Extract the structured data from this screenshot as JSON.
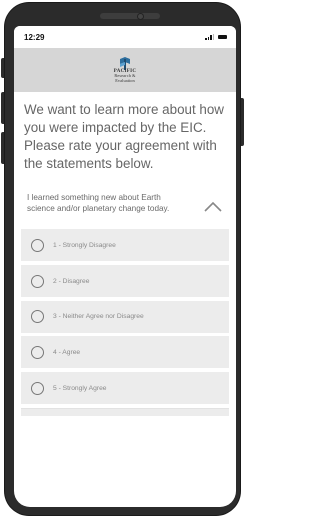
{
  "status_bar": {
    "time": "12:29"
  },
  "header": {
    "logo_icon": "pacific-logo-icon",
    "logo_line1": "PACIFIC",
    "logo_line2": "Research &",
    "logo_line3": "Evaluation"
  },
  "intro": {
    "text": "We want to learn more about how you were impacted by the EIC. Please rate your agreement with the statements below."
  },
  "question": {
    "text": "I learned something new about Earth science and/or planetary change today.",
    "toggle_icon": "chevron-up-icon"
  },
  "options": [
    {
      "label": "1 - Strongly Disagree",
      "selected": false
    },
    {
      "label": "2 - Disagree",
      "selected": false
    },
    {
      "label": "3 - Neither Agree nor Disagree",
      "selected": false
    },
    {
      "label": "4 - Agree",
      "selected": false
    },
    {
      "label": "5 - Strongly Agree",
      "selected": false
    }
  ],
  "colors": {
    "header_bg": "#d6d6d6",
    "option_bg": "#ececec",
    "text": "#666666",
    "device_frame": "#2b2b2b"
  }
}
